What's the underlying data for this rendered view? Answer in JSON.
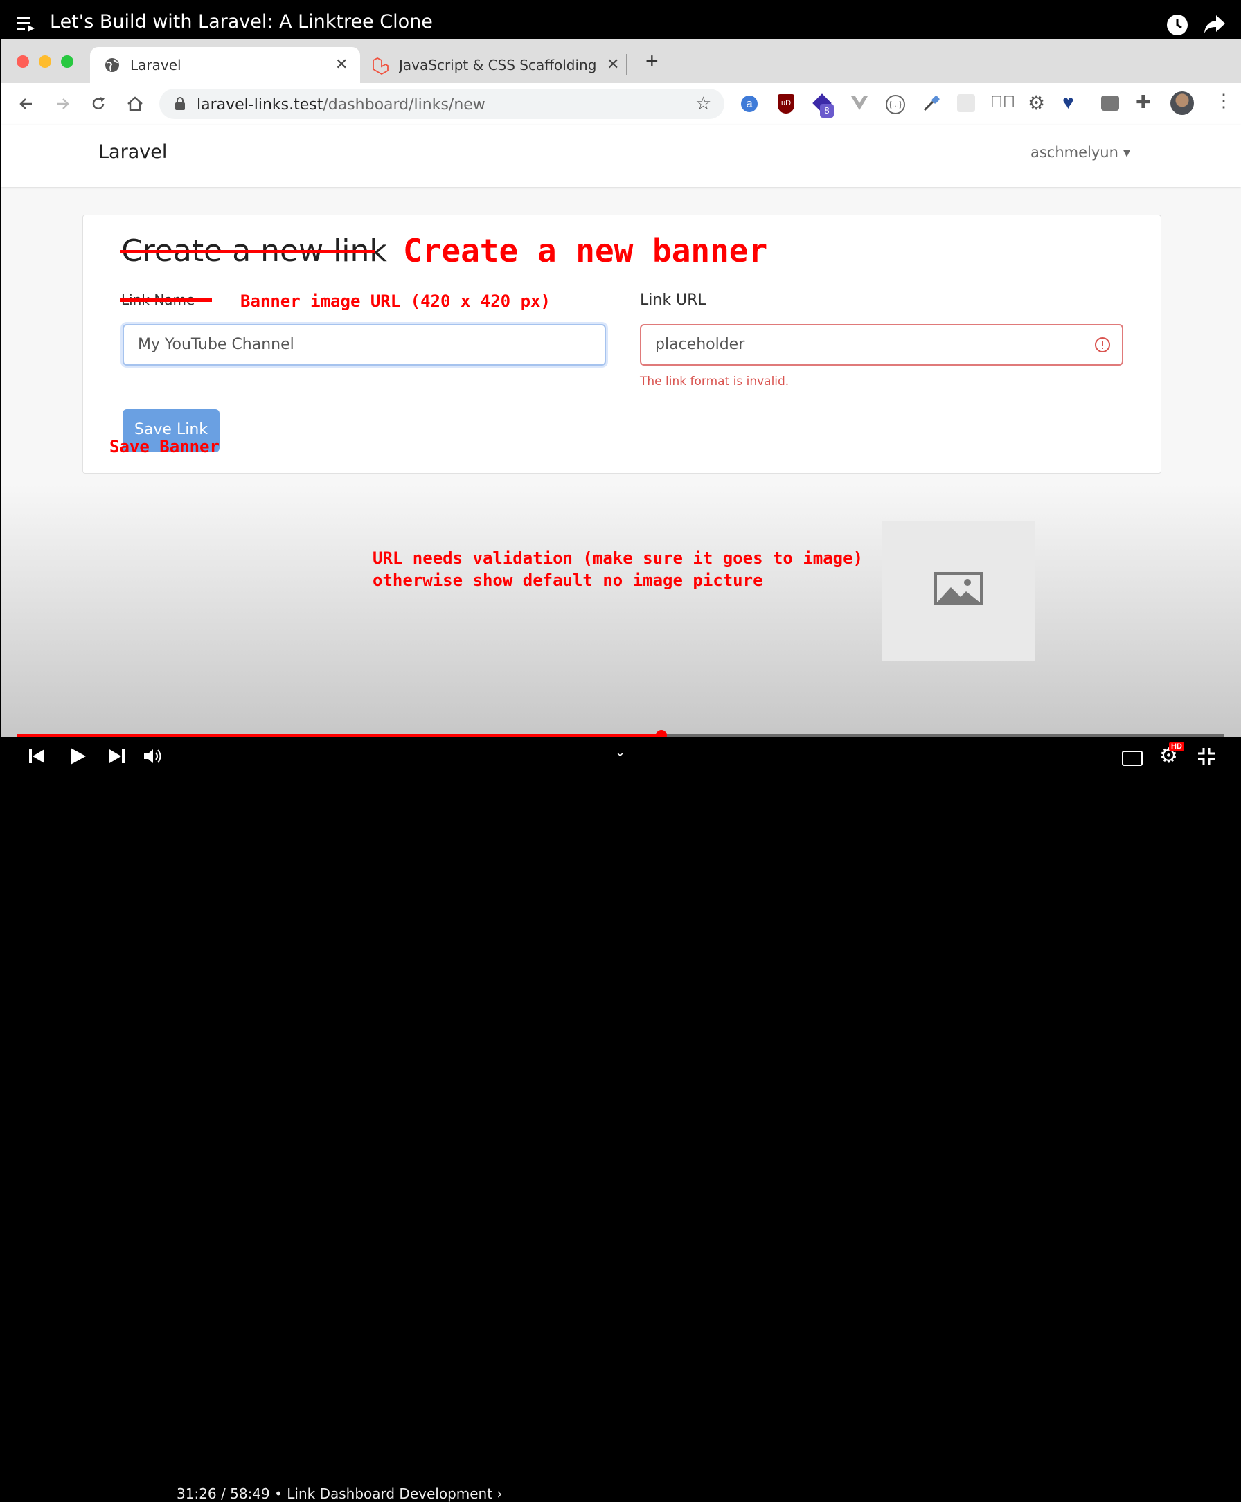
{
  "video": {
    "title": "Let's Build with Laravel: A Linktree Clone",
    "time": "31:26 / 58:49",
    "chapter": "• Link Dashboard Development ›",
    "progress_fraction": 0.534
  },
  "browser": {
    "tabs": [
      {
        "label": "Laravel"
      },
      {
        "label": "JavaScript & CSS Scaffolding -"
      }
    ],
    "url_host": "laravel-links.test",
    "url_path": "/dashboard/links/new",
    "extension_badge": "8"
  },
  "page": {
    "brand": "Laravel",
    "user": "aschmelyun",
    "heading": "Create a new link",
    "name_label": "Link Name",
    "name_value": "My YouTube Channel",
    "url_label": "Link URL",
    "url_value": "placeholder",
    "url_error": "The link format is invalid.",
    "save_button": "Save Link"
  },
  "annotations": {
    "heading": "Create a new banner",
    "name_label": "Banner image URL (420 x 420 px)",
    "save": "Save Banner",
    "note_line1": "URL needs validation (make sure it goes to image)",
    "note_line2": "otherwise show default no image picture"
  },
  "colors": {
    "annotation_red": "#ff0000",
    "primary_button": "#6aa0e2",
    "error_red": "#d9534f"
  }
}
